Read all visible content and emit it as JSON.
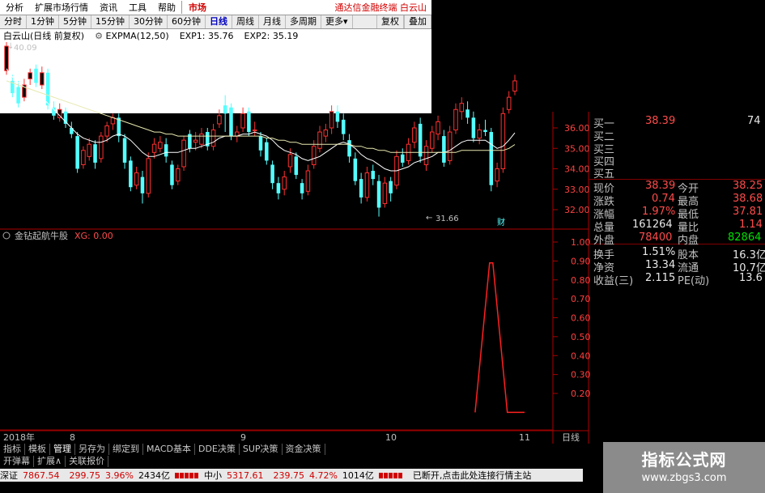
{
  "menubar": {
    "items": [
      "分析",
      "扩展市场行情",
      "资讯",
      "工具",
      "帮助"
    ],
    "market_label": "市场",
    "brand": "通达信金融终端  白云山"
  },
  "periods": {
    "items": [
      "分时",
      "1分钟",
      "5分钟",
      "15分钟",
      "30分钟",
      "60分钟",
      "日线",
      "周线",
      "月线",
      "多周期",
      "更多"
    ],
    "active": "日线",
    "right": [
      "复权",
      "叠加"
    ]
  },
  "titlebar": {
    "stock": "白云山(日线 前复权)",
    "indicator": "EXPMA(12,50)",
    "exp1": "EXP1: 35.76",
    "exp2": "EXP2: 35.19"
  },
  "indicator_title": {
    "name": "金钻起航牛股",
    "value": "XG: 0.00"
  },
  "annotations": {
    "high": "40.09",
    "low": "31.66",
    "badge": "财"
  },
  "y_axis_price": [
    "36.00",
    "35.00",
    "34.00",
    "33.00",
    "32.00"
  ],
  "y_axis_indicator": [
    "1.00",
    "0.90",
    "0.80",
    "0.70",
    "0.60",
    "0.50",
    "0.40",
    "0.30",
    "0.20"
  ],
  "x_axis": {
    "labels": [
      "2018年",
      "8",
      "9",
      "10",
      "11"
    ],
    "period_label": "日线"
  },
  "colors": {
    "up": "#ff3030",
    "down": "#54ffff",
    "exp1": "#ffffff",
    "exp2": "#f0f0a0",
    "grid": "#800000",
    "indicator": "#ff2020"
  },
  "quote": {
    "bids": [
      {
        "label": "买一",
        "price": "38.39",
        "vol": "74"
      },
      {
        "label": "买二",
        "price": "",
        "vol": ""
      },
      {
        "label": "买三",
        "price": "",
        "vol": ""
      },
      {
        "label": "买四",
        "price": "",
        "vol": ""
      },
      {
        "label": "买五",
        "price": "",
        "vol": ""
      }
    ],
    "rows": [
      {
        "l1": "现价",
        "v1": "38.39",
        "c1": "red",
        "l2": "今开",
        "v2": "38.25",
        "c2": "red"
      },
      {
        "l1": "涨跌",
        "v1": "0.74",
        "c1": "red",
        "l2": "最高",
        "v2": "38.68",
        "c2": "red"
      },
      {
        "l1": "涨幅",
        "v1": "1.97%",
        "c1": "red",
        "l2": "最低",
        "v2": "37.81",
        "c2": "red"
      },
      {
        "l1": "总量",
        "v1": "161264",
        "c1": "white",
        "l2": "量比",
        "v2": "1.14",
        "c2": "red"
      },
      {
        "l1": "外盘",
        "v1": "78400",
        "c1": "red",
        "l2": "内盘",
        "v2": "82864",
        "c2": "green"
      },
      {
        "l1": "换手",
        "v1": "1.51%",
        "c1": "white",
        "l2": "股本",
        "v2": "16.3亿",
        "c2": "white"
      },
      {
        "l1": "净资",
        "v1": "13.34",
        "c1": "white",
        "l2": "流通",
        "v2": "10.7亿",
        "c2": "white"
      },
      {
        "l1": "收益(三)",
        "v1": "2.115",
        "c1": "white",
        "l2": "PE(动)",
        "v2": "13.6",
        "c2": "white"
      }
    ]
  },
  "tabs": [
    "指标",
    "模板",
    "管理",
    "另存为",
    "绑定到",
    "MACD基本",
    "DDE决策",
    "SUP决策",
    "资金决策"
  ],
  "tabs_active": "管理",
  "subtabs": [
    "开弹幕",
    "扩展∧",
    "关联报价"
  ],
  "statusbar": {
    "sz_label": "深证",
    "sz_value": "7867.54",
    "sz_change": "299.75",
    "sz_pct": "3.96%",
    "sz_amount": "2434亿",
    "zx_label": "中小",
    "zx_value": "5317.61",
    "zx_change": "239.75",
    "zx_pct": "4.72%",
    "zx_amount": "1014亿",
    "message": "已断开,点击此处连接行情主站"
  },
  "watermark": {
    "line1": "指标公式网",
    "line2": "www.zbgs3.com"
  },
  "chart_data": {
    "type": "candlestick",
    "y_range": [
      31.5,
      40.3
    ],
    "indicator_range": [
      0.1,
      1.0
    ],
    "candles": [
      {
        "o": 38.8,
        "c": 40.0,
        "h": 40.2,
        "l": 38.6
      },
      {
        "o": 38.3,
        "c": 37.7,
        "h": 38.6,
        "l": 37.5
      },
      {
        "o": 38.0,
        "c": 37.2,
        "h": 38.3,
        "l": 37.0
      },
      {
        "o": 37.5,
        "c": 38.1,
        "h": 38.4,
        "l": 37.3
      },
      {
        "o": 38.4,
        "c": 38.7,
        "h": 38.9,
        "l": 38.1
      },
      {
        "o": 38.9,
        "c": 38.2,
        "h": 39.1,
        "l": 38.0
      },
      {
        "o": 38.1,
        "c": 38.7,
        "h": 39.0,
        "l": 37.9
      },
      {
        "o": 38.7,
        "c": 37.1,
        "h": 38.9,
        "l": 36.9
      },
      {
        "o": 37.0,
        "c": 36.6,
        "h": 37.3,
        "l": 36.4
      },
      {
        "o": 36.5,
        "c": 36.9,
        "h": 37.2,
        "l": 36.3
      },
      {
        "o": 36.8,
        "c": 36.2,
        "h": 37.0,
        "l": 36.0
      },
      {
        "o": 36.0,
        "c": 35.7,
        "h": 36.3,
        "l": 35.5
      },
      {
        "o": 35.6,
        "c": 34.0,
        "h": 35.8,
        "l": 33.8
      },
      {
        "o": 34.2,
        "c": 34.9,
        "h": 35.1,
        "l": 34.0
      },
      {
        "o": 34.6,
        "c": 35.2,
        "h": 35.5,
        "l": 34.4
      },
      {
        "o": 35.2,
        "c": 34.3,
        "h": 35.4,
        "l": 34.0
      },
      {
        "o": 34.5,
        "c": 35.6,
        "h": 35.8,
        "l": 34.3
      },
      {
        "o": 35.6,
        "c": 36.1,
        "h": 36.3,
        "l": 35.3
      },
      {
        "o": 36.2,
        "c": 36.5,
        "h": 36.7,
        "l": 35.9
      },
      {
        "o": 36.5,
        "c": 35.6,
        "h": 36.7,
        "l": 35.3
      },
      {
        "o": 35.5,
        "c": 34.3,
        "h": 35.7,
        "l": 34.0
      },
      {
        "o": 34.4,
        "c": 33.1,
        "h": 34.6,
        "l": 32.9
      },
      {
        "o": 33.2,
        "c": 33.8,
        "h": 34.1,
        "l": 33.0
      },
      {
        "o": 33.6,
        "c": 32.8,
        "h": 33.9,
        "l": 32.3
      },
      {
        "o": 32.8,
        "c": 34.5,
        "h": 34.8,
        "l": 32.6
      },
      {
        "o": 34.8,
        "c": 35.2,
        "h": 35.5,
        "l": 34.5
      },
      {
        "o": 35.0,
        "c": 35.3,
        "h": 35.6,
        "l": 34.8
      },
      {
        "o": 35.2,
        "c": 34.6,
        "h": 35.5,
        "l": 34.3
      },
      {
        "o": 34.2,
        "c": 33.2,
        "h": 34.4,
        "l": 33.0
      },
      {
        "o": 33.4,
        "c": 34.0,
        "h": 34.2,
        "l": 33.2
      },
      {
        "o": 34.1,
        "c": 35.4,
        "h": 35.6,
        "l": 33.9
      },
      {
        "o": 35.7,
        "c": 35.0,
        "h": 35.9,
        "l": 34.8
      },
      {
        "o": 35.3,
        "c": 35.4,
        "h": 35.8,
        "l": 34.9
      },
      {
        "o": 35.2,
        "c": 35.7,
        "h": 36.0,
        "l": 35.0
      },
      {
        "o": 35.8,
        "c": 35.1,
        "h": 36.0,
        "l": 34.9
      },
      {
        "o": 35.1,
        "c": 35.9,
        "h": 36.2,
        "l": 34.9
      },
      {
        "o": 36.2,
        "c": 36.6,
        "h": 36.9,
        "l": 36.0
      },
      {
        "o": 37.1,
        "c": 36.7,
        "h": 37.6,
        "l": 35.8
      },
      {
        "o": 37.0,
        "c": 35.6,
        "h": 37.2,
        "l": 35.4
      },
      {
        "o": 35.6,
        "c": 35.8,
        "h": 36.1,
        "l": 35.3
      },
      {
        "o": 36.0,
        "c": 36.7,
        "h": 37.0,
        "l": 35.8
      },
      {
        "o": 36.8,
        "c": 35.8,
        "h": 37.0,
        "l": 35.6
      },
      {
        "o": 35.9,
        "c": 35.9,
        "h": 36.3,
        "l": 35.6
      },
      {
        "o": 35.6,
        "c": 34.9,
        "h": 35.8,
        "l": 34.6
      },
      {
        "o": 35.3,
        "c": 34.4,
        "h": 35.5,
        "l": 34.2
      },
      {
        "o": 34.2,
        "c": 33.3,
        "h": 34.4,
        "l": 33.0
      },
      {
        "o": 33.3,
        "c": 32.8,
        "h": 33.6,
        "l": 32.5
      },
      {
        "o": 33.0,
        "c": 33.6,
        "h": 33.9,
        "l": 32.7
      },
      {
        "o": 34.1,
        "c": 34.7,
        "h": 35.0,
        "l": 33.8
      },
      {
        "o": 34.6,
        "c": 33.7,
        "h": 34.8,
        "l": 33.5
      },
      {
        "o": 33.3,
        "c": 32.8,
        "h": 33.5,
        "l": 32.5
      },
      {
        "o": 32.9,
        "c": 33.9,
        "h": 34.2,
        "l": 32.7
      },
      {
        "o": 34.2,
        "c": 35.1,
        "h": 35.4,
        "l": 34.0
      },
      {
        "o": 35.0,
        "c": 35.8,
        "h": 36.1,
        "l": 34.8
      },
      {
        "o": 35.6,
        "c": 35.9,
        "h": 36.2,
        "l": 35.3
      },
      {
        "o": 36.0,
        "c": 36.8,
        "h": 37.1,
        "l": 35.7
      },
      {
        "o": 36.8,
        "c": 36.3,
        "h": 37.1,
        "l": 36.0
      },
      {
        "o": 36.4,
        "c": 35.7,
        "h": 36.7,
        "l": 35.4
      },
      {
        "o": 35.4,
        "c": 34.6,
        "h": 35.7,
        "l": 34.3
      },
      {
        "o": 34.5,
        "c": 33.4,
        "h": 34.8,
        "l": 33.2
      },
      {
        "o": 33.5,
        "c": 32.6,
        "h": 33.8,
        "l": 32.3
      },
      {
        "o": 32.6,
        "c": 33.8,
        "h": 34.1,
        "l": 32.4
      },
      {
        "o": 33.9,
        "c": 33.5,
        "h": 34.2,
        "l": 33.2
      },
      {
        "o": 33.4,
        "c": 32.1,
        "h": 33.7,
        "l": 31.66
      },
      {
        "o": 32.3,
        "c": 33.3,
        "h": 33.6,
        "l": 32.1
      },
      {
        "o": 33.4,
        "c": 32.8,
        "h": 33.6,
        "l": 32.4
      },
      {
        "o": 33.2,
        "c": 34.6,
        "h": 34.9,
        "l": 33.0
      },
      {
        "o": 34.7,
        "c": 34.3,
        "h": 35.0,
        "l": 34.1
      },
      {
        "o": 34.4,
        "c": 35.2,
        "h": 35.5,
        "l": 34.2
      },
      {
        "o": 35.3,
        "c": 36.0,
        "h": 36.3,
        "l": 35.0
      },
      {
        "o": 36.2,
        "c": 34.6,
        "h": 36.5,
        "l": 34.3
      },
      {
        "o": 34.2,
        "c": 35.1,
        "h": 35.4,
        "l": 33.9
      },
      {
        "o": 35.0,
        "c": 35.8,
        "h": 36.1,
        "l": 34.8
      },
      {
        "o": 35.7,
        "c": 36.3,
        "h": 36.6,
        "l": 35.4
      },
      {
        "o": 35.6,
        "c": 34.3,
        "h": 35.9,
        "l": 34.1
      },
      {
        "o": 34.4,
        "c": 35.8,
        "h": 36.1,
        "l": 34.2
      },
      {
        "o": 35.9,
        "c": 36.9,
        "h": 37.2,
        "l": 35.7
      },
      {
        "o": 36.8,
        "c": 37.2,
        "h": 37.5,
        "l": 36.4
      },
      {
        "o": 36.9,
        "c": 36.5,
        "h": 37.3,
        "l": 36.2
      },
      {
        "o": 36.5,
        "c": 35.5,
        "h": 36.8,
        "l": 35.3
      },
      {
        "o": 35.5,
        "c": 35.9,
        "h": 36.2,
        "l": 35.2
      },
      {
        "o": 35.9,
        "c": 35.8,
        "h": 36.4,
        "l": 35.6
      },
      {
        "o": 35.8,
        "c": 33.2,
        "h": 36.0,
        "l": 32.9
      },
      {
        "o": 33.4,
        "c": 34.0,
        "h": 34.3,
        "l": 33.1
      },
      {
        "o": 34.0,
        "c": 36.7,
        "h": 37.0,
        "l": 33.8
      },
      {
        "o": 36.9,
        "c": 37.5,
        "h": 37.8,
        "l": 36.7
      },
      {
        "o": 37.8,
        "c": 38.3,
        "h": 38.6,
        "l": 37.6
      }
    ],
    "exp1": [
      38.9,
      38.5,
      38.2,
      38.0,
      37.9,
      37.7,
      37.5,
      37.2,
      36.9,
      36.6,
      36.3,
      36.0,
      35.7,
      35.5,
      35.4,
      35.3,
      35.3,
      35.4,
      35.6,
      35.7,
      35.6,
      35.4,
      35.1,
      34.8,
      34.6,
      34.6,
      34.7,
      34.8,
      34.8,
      34.8,
      34.9,
      35.0,
      35.0,
      35.1,
      35.2,
      35.3,
      35.5,
      35.6,
      35.6,
      35.6,
      35.7,
      35.7,
      35.8,
      35.7,
      35.6,
      35.4,
      35.1,
      34.9,
      34.8,
      34.7,
      34.5,
      34.4,
      34.5,
      34.6,
      34.8,
      35.0,
      35.2,
      35.3,
      35.2,
      35.0,
      34.7,
      34.5,
      34.4,
      34.2,
      34.0,
      33.9,
      33.9,
      34.0,
      34.1,
      34.3,
      34.4,
      34.5,
      34.6,
      34.8,
      34.8,
      34.9,
      35.1,
      35.3,
      35.4,
      35.4,
      35.4,
      35.4,
      35.2,
      35.0,
      35.1,
      35.4,
      35.76
    ],
    "exp2": [
      38.3,
      38.2,
      38.1,
      38.0,
      37.9,
      37.8,
      37.7,
      37.6,
      37.5,
      37.4,
      37.3,
      37.2,
      37.1,
      37.0,
      36.9,
      36.8,
      36.7,
      36.6,
      36.5,
      36.4,
      36.3,
      36.2,
      36.1,
      36.0,
      35.9,
      35.8,
      35.8,
      35.7,
      35.7,
      35.6,
      35.6,
      35.6,
      35.6,
      35.6,
      35.6,
      35.6,
      35.6,
      35.6,
      35.6,
      35.6,
      35.6,
      35.6,
      35.6,
      35.6,
      35.5,
      35.5,
      35.4,
      35.4,
      35.3,
      35.3,
      35.2,
      35.2,
      35.2,
      35.2,
      35.2,
      35.2,
      35.2,
      35.2,
      35.2,
      35.1,
      35.1,
      35.0,
      35.0,
      34.9,
      34.9,
      34.8,
      34.8,
      34.8,
      34.8,
      34.8,
      34.8,
      34.8,
      34.8,
      34.8,
      34.8,
      34.8,
      34.8,
      34.9,
      34.9,
      34.9,
      34.9,
      34.9,
      34.9,
      34.9,
      34.9,
      35.0,
      35.19
    ],
    "indicator": {
      "flat": 0.1,
      "peak_index": 82,
      "peak_value": 0.89,
      "start_index": 79,
      "end_index": 85
    }
  }
}
